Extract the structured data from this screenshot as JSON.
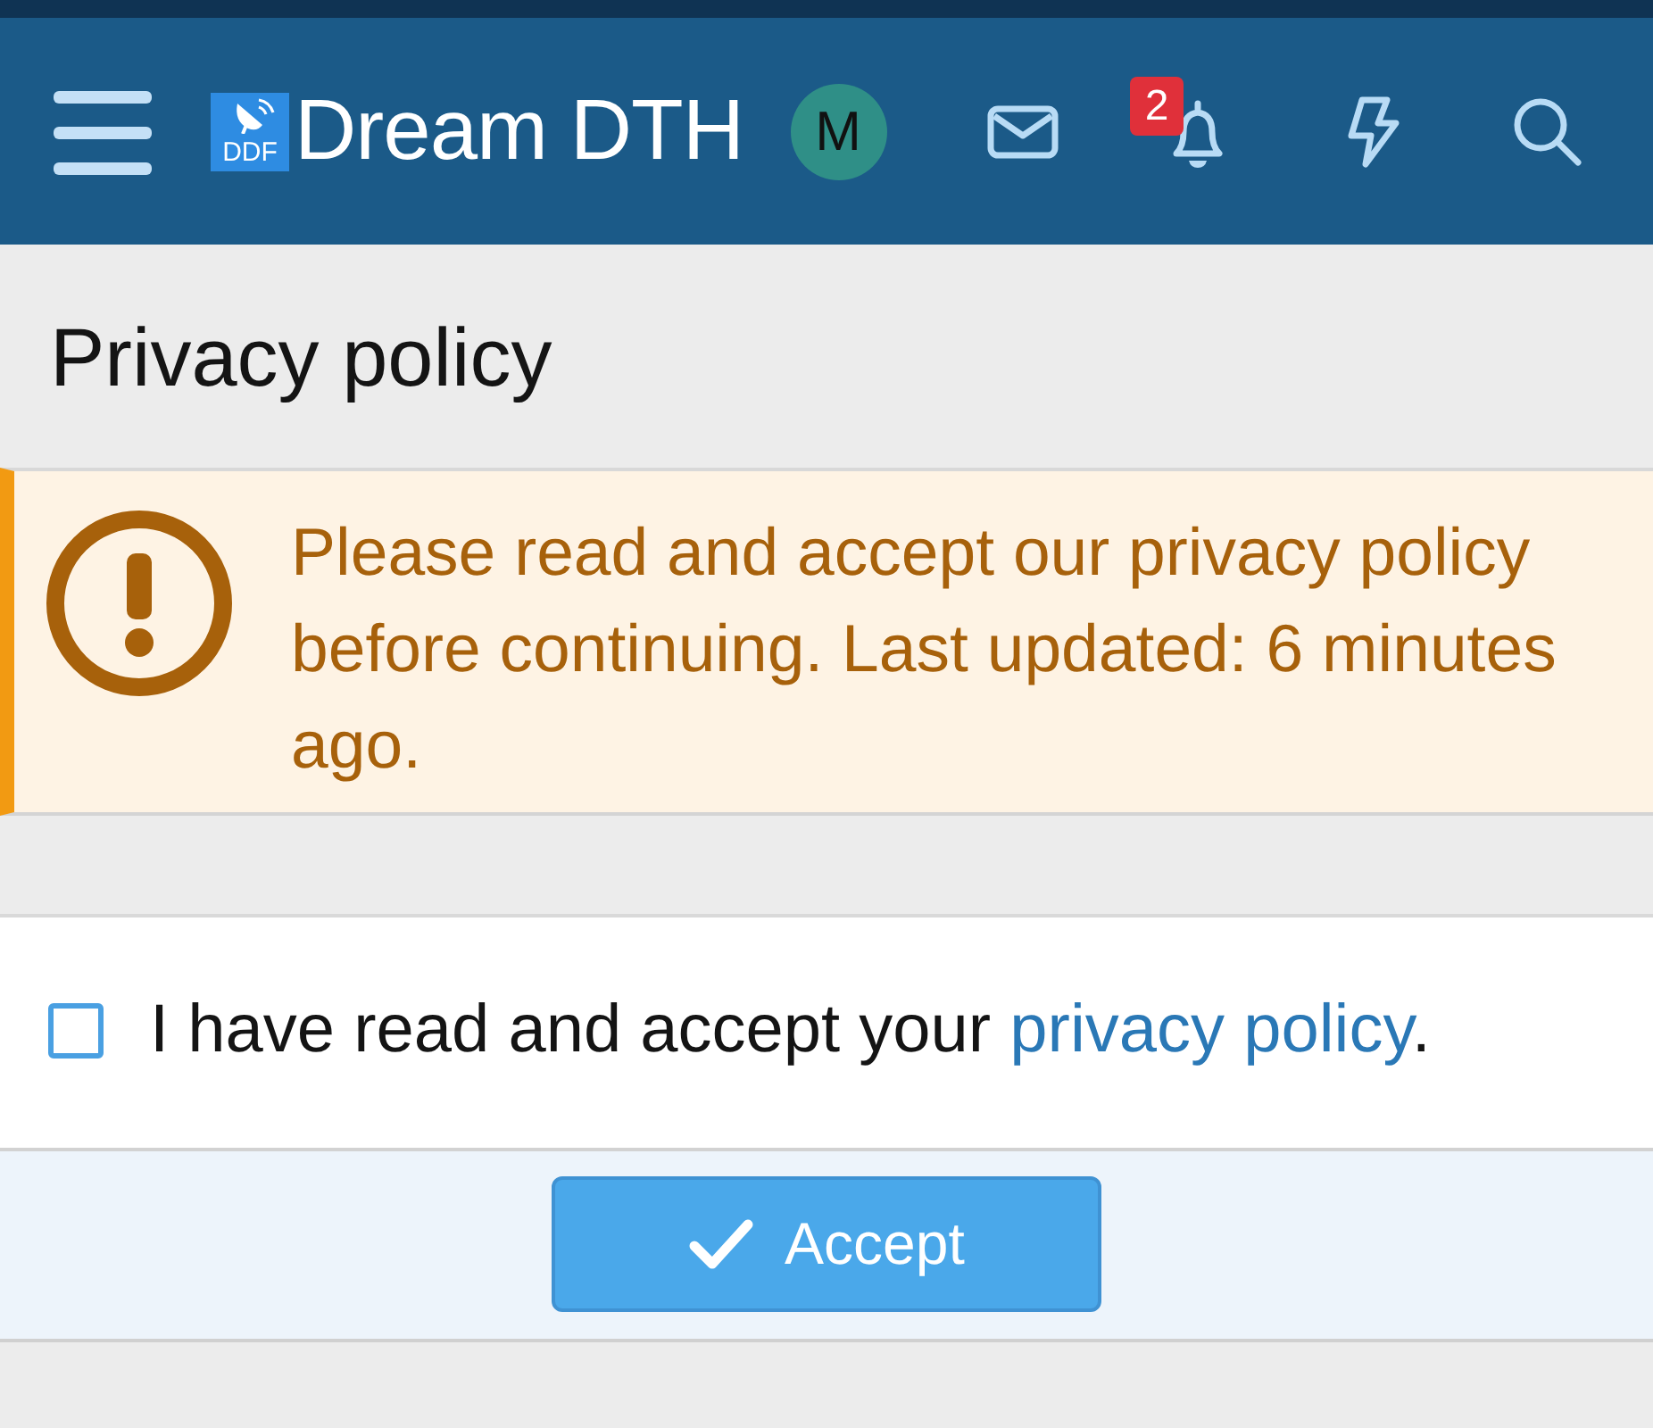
{
  "header": {
    "logo": {
      "badge": "DDF",
      "name": "Dream DTH"
    },
    "avatar": {
      "initial": "M"
    },
    "notifications": {
      "badge": "2"
    }
  },
  "page": {
    "title": "Privacy policy"
  },
  "notice": {
    "kind": "warning",
    "text": "Please read and accept our privacy policy before continuing. Last updated: 6 minutes ago."
  },
  "consent": {
    "checked": false,
    "label": "I have read and accept your ",
    "link": "privacy policy",
    "suffix": "."
  },
  "actions": [
    {
      "label": "Accept",
      "kind": "primary"
    }
  ]
}
